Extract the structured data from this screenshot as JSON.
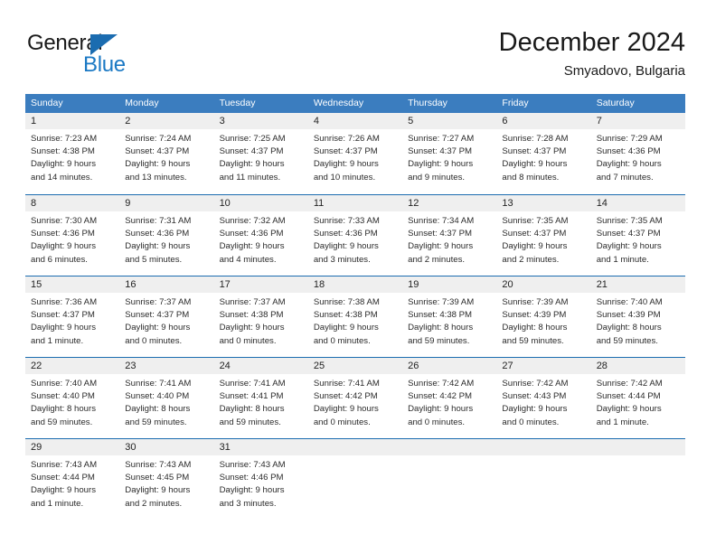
{
  "brand": {
    "name_part1": "General",
    "name_part2": "Blue",
    "triangle_color": "#1b6cb0",
    "blue_color": "#1b79c4"
  },
  "header": {
    "title": "December 2024",
    "subtitle": "Smyadovo, Bulgaria"
  },
  "theme": {
    "header_bar_color": "#3b7dbf",
    "week_divider_color": "#1b6cb0",
    "day_band_color": "#efefef",
    "text_color": "#2b2b2b"
  },
  "weekdays": [
    "Sunday",
    "Monday",
    "Tuesday",
    "Wednesday",
    "Thursday",
    "Friday",
    "Saturday"
  ],
  "weeks": [
    [
      {
        "day": "1",
        "sunrise": "Sunrise: 7:23 AM",
        "sunset": "Sunset: 4:38 PM",
        "daylight1": "Daylight: 9 hours",
        "daylight2": "and 14 minutes."
      },
      {
        "day": "2",
        "sunrise": "Sunrise: 7:24 AM",
        "sunset": "Sunset: 4:37 PM",
        "daylight1": "Daylight: 9 hours",
        "daylight2": "and 13 minutes."
      },
      {
        "day": "3",
        "sunrise": "Sunrise: 7:25 AM",
        "sunset": "Sunset: 4:37 PM",
        "daylight1": "Daylight: 9 hours",
        "daylight2": "and 11 minutes."
      },
      {
        "day": "4",
        "sunrise": "Sunrise: 7:26 AM",
        "sunset": "Sunset: 4:37 PM",
        "daylight1": "Daylight: 9 hours",
        "daylight2": "and 10 minutes."
      },
      {
        "day": "5",
        "sunrise": "Sunrise: 7:27 AM",
        "sunset": "Sunset: 4:37 PM",
        "daylight1": "Daylight: 9 hours",
        "daylight2": "and 9 minutes."
      },
      {
        "day": "6",
        "sunrise": "Sunrise: 7:28 AM",
        "sunset": "Sunset: 4:37 PM",
        "daylight1": "Daylight: 9 hours",
        "daylight2": "and 8 minutes."
      },
      {
        "day": "7",
        "sunrise": "Sunrise: 7:29 AM",
        "sunset": "Sunset: 4:36 PM",
        "daylight1": "Daylight: 9 hours",
        "daylight2": "and 7 minutes."
      }
    ],
    [
      {
        "day": "8",
        "sunrise": "Sunrise: 7:30 AM",
        "sunset": "Sunset: 4:36 PM",
        "daylight1": "Daylight: 9 hours",
        "daylight2": "and 6 minutes."
      },
      {
        "day": "9",
        "sunrise": "Sunrise: 7:31 AM",
        "sunset": "Sunset: 4:36 PM",
        "daylight1": "Daylight: 9 hours",
        "daylight2": "and 5 minutes."
      },
      {
        "day": "10",
        "sunrise": "Sunrise: 7:32 AM",
        "sunset": "Sunset: 4:36 PM",
        "daylight1": "Daylight: 9 hours",
        "daylight2": "and 4 minutes."
      },
      {
        "day": "11",
        "sunrise": "Sunrise: 7:33 AM",
        "sunset": "Sunset: 4:36 PM",
        "daylight1": "Daylight: 9 hours",
        "daylight2": "and 3 minutes."
      },
      {
        "day": "12",
        "sunrise": "Sunrise: 7:34 AM",
        "sunset": "Sunset: 4:37 PM",
        "daylight1": "Daylight: 9 hours",
        "daylight2": "and 2 minutes."
      },
      {
        "day": "13",
        "sunrise": "Sunrise: 7:35 AM",
        "sunset": "Sunset: 4:37 PM",
        "daylight1": "Daylight: 9 hours",
        "daylight2": "and 2 minutes."
      },
      {
        "day": "14",
        "sunrise": "Sunrise: 7:35 AM",
        "sunset": "Sunset: 4:37 PM",
        "daylight1": "Daylight: 9 hours",
        "daylight2": "and 1 minute."
      }
    ],
    [
      {
        "day": "15",
        "sunrise": "Sunrise: 7:36 AM",
        "sunset": "Sunset: 4:37 PM",
        "daylight1": "Daylight: 9 hours",
        "daylight2": "and 1 minute."
      },
      {
        "day": "16",
        "sunrise": "Sunrise: 7:37 AM",
        "sunset": "Sunset: 4:37 PM",
        "daylight1": "Daylight: 9 hours",
        "daylight2": "and 0 minutes."
      },
      {
        "day": "17",
        "sunrise": "Sunrise: 7:37 AM",
        "sunset": "Sunset: 4:38 PM",
        "daylight1": "Daylight: 9 hours",
        "daylight2": "and 0 minutes."
      },
      {
        "day": "18",
        "sunrise": "Sunrise: 7:38 AM",
        "sunset": "Sunset: 4:38 PM",
        "daylight1": "Daylight: 9 hours",
        "daylight2": "and 0 minutes."
      },
      {
        "day": "19",
        "sunrise": "Sunrise: 7:39 AM",
        "sunset": "Sunset: 4:38 PM",
        "daylight1": "Daylight: 8 hours",
        "daylight2": "and 59 minutes."
      },
      {
        "day": "20",
        "sunrise": "Sunrise: 7:39 AM",
        "sunset": "Sunset: 4:39 PM",
        "daylight1": "Daylight: 8 hours",
        "daylight2": "and 59 minutes."
      },
      {
        "day": "21",
        "sunrise": "Sunrise: 7:40 AM",
        "sunset": "Sunset: 4:39 PM",
        "daylight1": "Daylight: 8 hours",
        "daylight2": "and 59 minutes."
      }
    ],
    [
      {
        "day": "22",
        "sunrise": "Sunrise: 7:40 AM",
        "sunset": "Sunset: 4:40 PM",
        "daylight1": "Daylight: 8 hours",
        "daylight2": "and 59 minutes."
      },
      {
        "day": "23",
        "sunrise": "Sunrise: 7:41 AM",
        "sunset": "Sunset: 4:40 PM",
        "daylight1": "Daylight: 8 hours",
        "daylight2": "and 59 minutes."
      },
      {
        "day": "24",
        "sunrise": "Sunrise: 7:41 AM",
        "sunset": "Sunset: 4:41 PM",
        "daylight1": "Daylight: 8 hours",
        "daylight2": "and 59 minutes."
      },
      {
        "day": "25",
        "sunrise": "Sunrise: 7:41 AM",
        "sunset": "Sunset: 4:42 PM",
        "daylight1": "Daylight: 9 hours",
        "daylight2": "and 0 minutes."
      },
      {
        "day": "26",
        "sunrise": "Sunrise: 7:42 AM",
        "sunset": "Sunset: 4:42 PM",
        "daylight1": "Daylight: 9 hours",
        "daylight2": "and 0 minutes."
      },
      {
        "day": "27",
        "sunrise": "Sunrise: 7:42 AM",
        "sunset": "Sunset: 4:43 PM",
        "daylight1": "Daylight: 9 hours",
        "daylight2": "and 0 minutes."
      },
      {
        "day": "28",
        "sunrise": "Sunrise: 7:42 AM",
        "sunset": "Sunset: 4:44 PM",
        "daylight1": "Daylight: 9 hours",
        "daylight2": "and 1 minute."
      }
    ],
    [
      {
        "day": "29",
        "sunrise": "Sunrise: 7:43 AM",
        "sunset": "Sunset: 4:44 PM",
        "daylight1": "Daylight: 9 hours",
        "daylight2": "and 1 minute."
      },
      {
        "day": "30",
        "sunrise": "Sunrise: 7:43 AM",
        "sunset": "Sunset: 4:45 PM",
        "daylight1": "Daylight: 9 hours",
        "daylight2": "and 2 minutes."
      },
      {
        "day": "31",
        "sunrise": "Sunrise: 7:43 AM",
        "sunset": "Sunset: 4:46 PM",
        "daylight1": "Daylight: 9 hours",
        "daylight2": "and 3 minutes."
      },
      {
        "day": "",
        "sunrise": "",
        "sunset": "",
        "daylight1": "",
        "daylight2": ""
      },
      {
        "day": "",
        "sunrise": "",
        "sunset": "",
        "daylight1": "",
        "daylight2": ""
      },
      {
        "day": "",
        "sunrise": "",
        "sunset": "",
        "daylight1": "",
        "daylight2": ""
      },
      {
        "day": "",
        "sunrise": "",
        "sunset": "",
        "daylight1": "",
        "daylight2": ""
      }
    ]
  ]
}
